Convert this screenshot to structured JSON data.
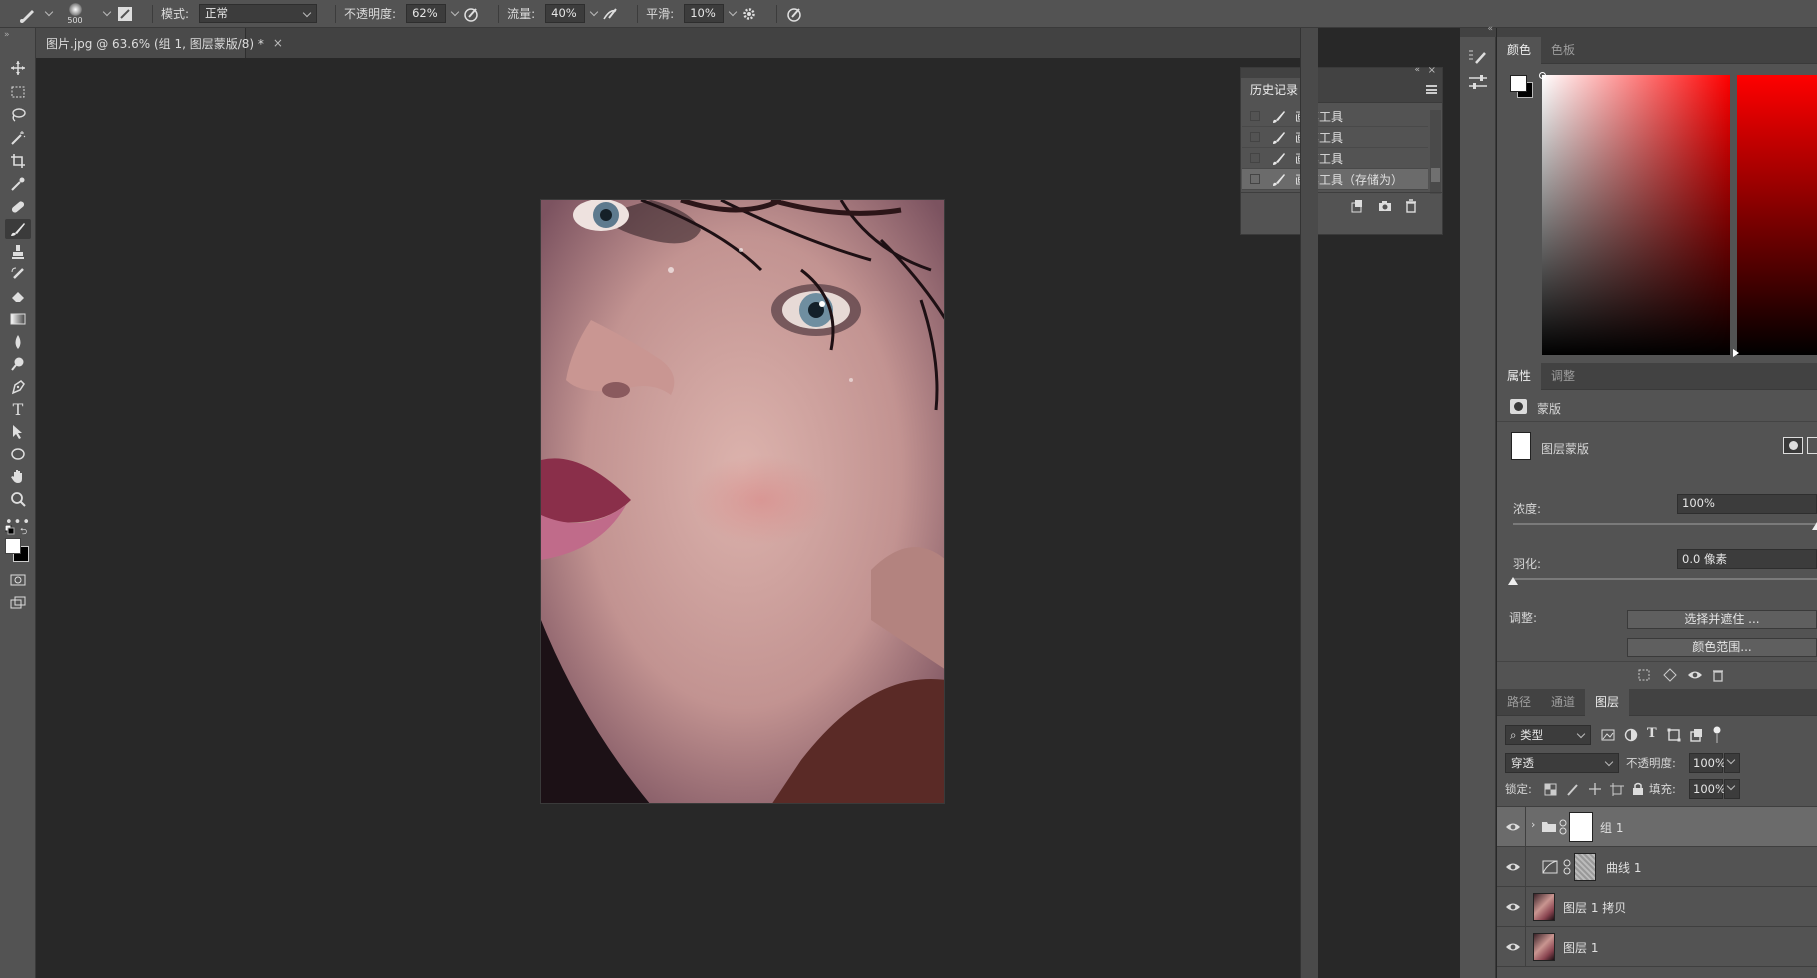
{
  "options_bar": {
    "brush_size": "500",
    "mode_label": "模式:",
    "mode_value": "正常",
    "opacity_label": "不透明度:",
    "opacity_value": "62%",
    "flow_label": "流量:",
    "flow_value": "40%",
    "smooth_label": "平滑:",
    "smooth_value": "10%"
  },
  "document": {
    "tab_title": "图片.jpg @ 63.6% (组 1, 图层蒙版/8) *",
    "close_glyph": "×"
  },
  "history_panel": {
    "title": "历史记录",
    "items": [
      {
        "label": "画笔工具",
        "selected": false
      },
      {
        "label": "画笔工具",
        "selected": false
      },
      {
        "label": "画笔工具",
        "selected": false
      },
      {
        "label": "画笔工具（存储为）",
        "selected": true
      }
    ]
  },
  "color_panel": {
    "tabs": [
      "颜色",
      "色板"
    ],
    "foreground": "#ffffff",
    "background": "#000000",
    "hue_color": "#ff0000"
  },
  "properties_panel": {
    "tabs": [
      "属性",
      "调整"
    ],
    "section_label": "蒙版",
    "mask_label": "图层蒙版",
    "density_label": "浓度:",
    "density_value": "100%",
    "density_fraction": 1.0,
    "feather_label": "羽化:",
    "feather_value": "0.0 像素",
    "feather_fraction": 0.0,
    "adjust_label": "调整:",
    "select_mask_button": "选择并遮住 ...",
    "color_range_button": "颜色范围..."
  },
  "layers_panel": {
    "tabs": [
      "路径",
      "通道",
      "图层"
    ],
    "filter_label": "类型",
    "blend_mode": "穿透",
    "opacity_label": "不透明度:",
    "opacity_value": "100%",
    "lock_label": "锁定:",
    "fill_label": "填充:",
    "fill_value": "100%",
    "layers": [
      {
        "name": "组 1",
        "type": "group",
        "selected": true
      },
      {
        "name": "曲线 1",
        "type": "curves",
        "selected": false
      },
      {
        "name": "图层 1 拷贝",
        "type": "image",
        "selected": false
      },
      {
        "name": "图层 1",
        "type": "image",
        "selected": false
      }
    ]
  },
  "colors": {
    "ui_bg": "#535353",
    "canvas_bg": "#282828",
    "selected": "#6b6b6b"
  }
}
